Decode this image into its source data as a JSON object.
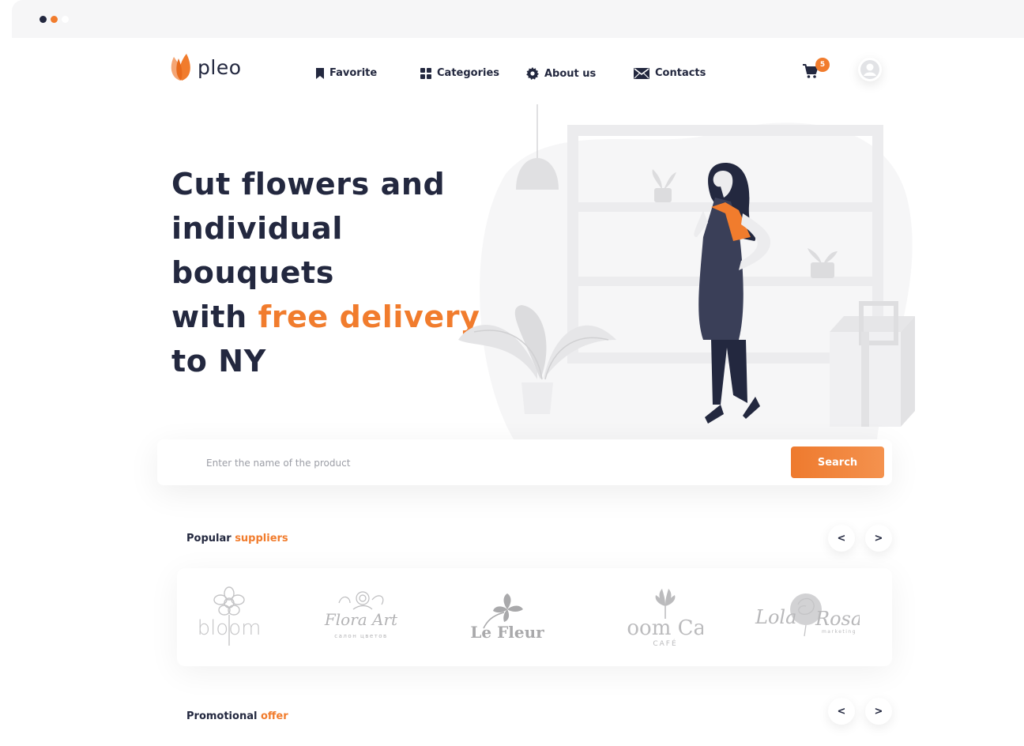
{
  "window": {
    "dot_colors": [
      "#23283f",
      "#f17c2d",
      "#ffffff"
    ]
  },
  "header": {
    "logo_text": "pleo",
    "nav": [
      {
        "label": "Favorite",
        "icon": "bookmark-icon"
      },
      {
        "label": "Categories",
        "icon": "grid-icon"
      },
      {
        "label": "About us",
        "icon": "gear-icon"
      },
      {
        "label": "Contacts",
        "icon": "envelope-icon"
      }
    ],
    "cart_count": "5"
  },
  "hero": {
    "line1": "Cut flowers and",
    "line2": "individual bouquets",
    "line3_prefix": "with ",
    "line3_accent": "free delivery",
    "line4": "to NY"
  },
  "search": {
    "placeholder": "Enter the name of the product",
    "value": "",
    "button_label": "Search"
  },
  "suppliers": {
    "title_main": "Popular ",
    "title_accent": "suppliers",
    "prev_label": "<",
    "next_label": ">",
    "brands": [
      "bloom",
      "Flora Art",
      "Le Fleur",
      "Bloom Café",
      "Lola Rosa"
    ],
    "brand_texts": {
      "flora_sub": "салон цветов",
      "bloom_cafe_sub": "CAFÉ",
      "lola_left": "Lola",
      "lola_right": "Rosa",
      "lola_sub": "marketing"
    }
  },
  "promo": {
    "title_main": "Promotional ",
    "title_accent": "offer",
    "prev_label": "<",
    "next_label": ">"
  },
  "colors": {
    "accent": "#f17c2d",
    "dark": "#23283f",
    "muted": "#9c9ea6"
  }
}
